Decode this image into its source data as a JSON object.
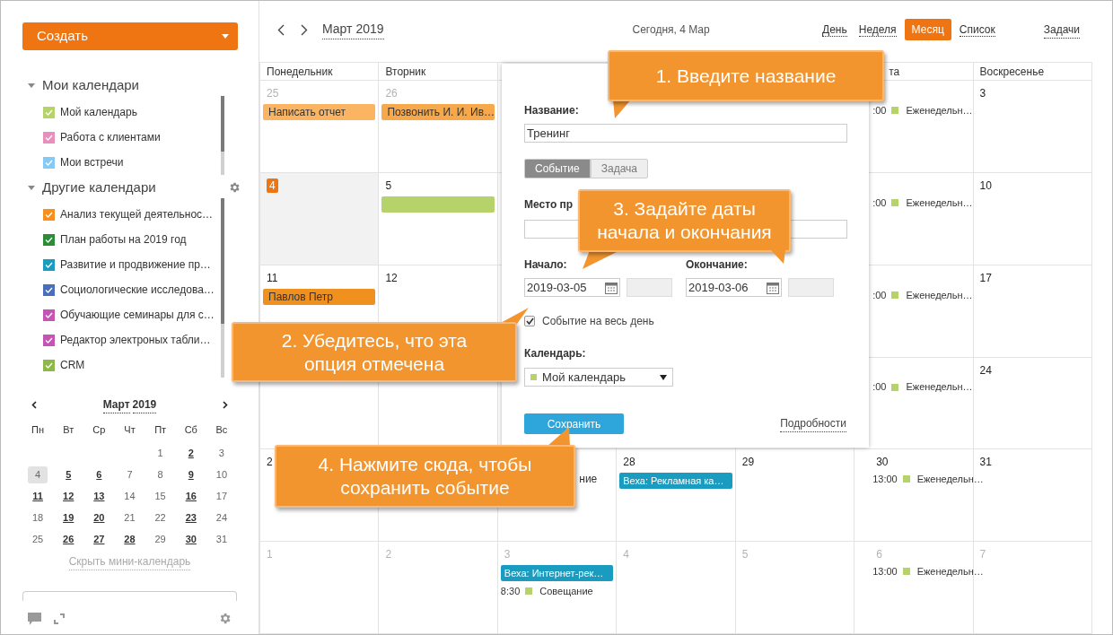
{
  "sidebar": {
    "create_button": "Создать",
    "my_calendars": {
      "title": "Мои календари",
      "expanded": true,
      "items": [
        {
          "label": "Мой календарь",
          "color": "#b5d36a",
          "checked": true
        },
        {
          "label": "Работа с клиентами",
          "color": "#e88fbc",
          "checked": true
        },
        {
          "label": "Мои встречи",
          "color": "#86c9f4",
          "checked": true
        }
      ]
    },
    "other_calendars": {
      "title": "Другие календари",
      "expanded": true,
      "items": [
        {
          "label": "Анализ текущей деятельнос…",
          "color": "#f7901e",
          "checked": true
        },
        {
          "label": "План работы на 2019 год",
          "color": "#2e8b3a",
          "checked": true
        },
        {
          "label": "Развитие и продвижение пр…",
          "color": "#1a9cc0",
          "checked": true
        },
        {
          "label": "Социологические исследова…",
          "color": "#4a6fb8",
          "checked": true
        },
        {
          "label": "Обучающие семинары для с…",
          "color": "#c455b5",
          "checked": true
        },
        {
          "label": "Редактор электроных табли…",
          "color": "#c455b5",
          "checked": true
        },
        {
          "label": "CRM",
          "color": "#8db84a",
          "checked": true
        }
      ]
    },
    "mini_calendar": {
      "month": "Март",
      "year": "2019",
      "weekdays": [
        "Пн",
        "Вт",
        "Ср",
        "Чт",
        "Пт",
        "Сб",
        "Вс"
      ],
      "weeks": [
        [
          {
            "day": "1",
            "has_events": false,
            "today": false
          },
          {
            "day": "2",
            "has_events": true,
            "today": false
          },
          {
            "day": "3",
            "has_events": false,
            "today": false
          }
        ],
        [
          {
            "day": "4",
            "has_events": false,
            "today": true
          },
          {
            "day": "5",
            "has_events": true,
            "today": false
          },
          {
            "day": "6",
            "has_events": true,
            "today": false
          },
          {
            "day": "7",
            "has_events": false,
            "today": false
          },
          {
            "day": "8",
            "has_events": false,
            "today": false
          },
          {
            "day": "9",
            "has_events": true,
            "today": false
          },
          {
            "day": "10",
            "has_events": false,
            "today": false
          }
        ],
        [
          {
            "day": "11",
            "has_events": true,
            "today": false
          },
          {
            "day": "12",
            "has_events": true,
            "today": false
          },
          {
            "day": "13",
            "has_events": true,
            "today": false
          },
          {
            "day": "14",
            "has_events": false,
            "today": false
          },
          {
            "day": "15",
            "has_events": false,
            "today": false
          },
          {
            "day": "16",
            "has_events": true,
            "today": false
          },
          {
            "day": "17",
            "has_events": false,
            "today": false
          }
        ],
        [
          {
            "day": "18",
            "has_events": false,
            "today": false
          },
          {
            "day": "19",
            "has_events": true,
            "today": false
          },
          {
            "day": "20",
            "has_events": true,
            "today": false
          },
          {
            "day": "21",
            "has_events": false,
            "today": false
          },
          {
            "day": "22",
            "has_events": false,
            "today": false
          },
          {
            "day": "23",
            "has_events": true,
            "today": false
          },
          {
            "day": "24",
            "has_events": false,
            "today": false
          }
        ],
        [
          {
            "day": "25",
            "has_events": false,
            "today": false
          },
          {
            "day": "26",
            "has_events": true,
            "today": false
          },
          {
            "day": "27",
            "has_events": true,
            "today": false
          },
          {
            "day": "28",
            "has_events": true,
            "today": false
          },
          {
            "day": "29",
            "has_events": false,
            "today": false
          },
          {
            "day": "30",
            "has_events": true,
            "today": false
          },
          {
            "day": "31",
            "has_events": false,
            "today": false
          }
        ]
      ],
      "hide_link": "Скрыть мини-календарь"
    }
  },
  "toolbar": {
    "period": "Март 2019",
    "today": "Сегодня, 4 Мар",
    "views": [
      {
        "label": "День",
        "selected": false
      },
      {
        "label": "Неделя",
        "selected": false
      },
      {
        "label": "Месяц",
        "selected": true
      },
      {
        "label": "Список",
        "selected": false
      }
    ],
    "tasks": "Задачи"
  },
  "calendar": {
    "columns": {
      "mon": "Понедельник",
      "tue": "Вторник",
      "sat": "та",
      "sun": "Воскресенье"
    },
    "weeks": [
      {
        "mon": {
          "day": "25",
          "muted": true,
          "today": false,
          "events": [
            {
              "kind": "bar",
              "title": "Написать отчет",
              "color": "#fbb462"
            }
          ]
        },
        "tue": {
          "day": "26",
          "muted": true,
          "today": false,
          "events": [
            {
              "kind": "bar",
              "title": "Позвонить И. И. Ив…",
              "color": "#f7a84a"
            }
          ]
        },
        "sat": {
          "events": [
            {
              "kind": "timed",
              "time": ":00",
              "title": "Еженедельн…",
              "color": "#b5d36a"
            }
          ]
        },
        "sun": {
          "day": "3",
          "muted": false,
          "today": false
        }
      },
      {
        "mon": {
          "day": "4",
          "muted": false,
          "today": true
        },
        "tue": {
          "day": "5",
          "muted": false,
          "today": false,
          "events": [
            {
              "kind": "bar",
              "color": "#b5d36a"
            }
          ]
        },
        "sat": {
          "events": [
            {
              "kind": "timed",
              "time": ":00",
              "title": "Еженедельн…",
              "color": "#b5d36a"
            }
          ]
        },
        "sun": {
          "day": "10",
          "muted": false,
          "today": false
        }
      },
      {
        "mon": {
          "day": "11",
          "muted": false,
          "today": false,
          "events": [
            {
              "kind": "bar",
              "title": "Павлов Петр",
              "color": "#f0901e"
            }
          ]
        },
        "tue": {
          "day": "12",
          "muted": false,
          "today": false
        },
        "sat": {
          "events": [
            {
              "kind": "timed",
              "time": ":00",
              "title": "Еженедельн…",
              "color": "#b5d36a"
            }
          ]
        },
        "sun": {
          "day": "17",
          "muted": false,
          "today": false
        }
      },
      {
        "sat": {
          "events": [
            {
              "kind": "timed",
              "time": ":00",
              "title": "Еженедельн…",
              "color": "#b5d36a"
            }
          ]
        },
        "sun": {
          "day": "24",
          "muted": false,
          "today": false
        }
      },
      {
        "mon": {
          "day": "2",
          "muted": false,
          "today": false
        },
        "wed": {
          "events": [
            {
              "kind": "fragment",
              "title": "ние"
            }
          ]
        },
        "thu": {
          "day": "28",
          "muted": false,
          "today": false,
          "events": [
            {
              "kind": "milestone",
              "title": "Веха: Рекламная ка…",
              "color": "#1a9cc0"
            }
          ]
        },
        "fri": {
          "day": "29",
          "muted": false,
          "today": false
        },
        "sat": {
          "day": "30",
          "muted": false,
          "today": false,
          "events": [
            {
              "kind": "timed",
              "time": "13:00",
              "title": "Еженедельн…",
              "color": "#b5d36a"
            }
          ]
        },
        "sun": {
          "day": "31",
          "muted": false,
          "today": false
        }
      },
      {
        "mon": {
          "day": "1",
          "muted": true,
          "today": false
        },
        "tue": {
          "day": "2",
          "muted": true,
          "today": false
        },
        "wed": {
          "day": "3",
          "muted": true,
          "today": false,
          "events": [
            {
              "kind": "milestone",
              "title": "Веха: Интернет-рек…",
              "color": "#1a9cc0"
            },
            {
              "kind": "timed",
              "time": "8:30",
              "title": "Совещание",
              "color": "#b5d36a"
            }
          ]
        },
        "thu": {
          "day": "4",
          "muted": true,
          "today": false
        },
        "fri": {
          "day": "5",
          "muted": true,
          "today": false
        },
        "sat": {
          "day": "6",
          "muted": true,
          "today": false,
          "events": [
            {
              "kind": "timed",
              "time": "13:00",
              "title": "Еженедельн…",
              "color": "#b5d36a"
            }
          ]
        },
        "sun": {
          "day": "7",
          "muted": true,
          "today": false
        }
      }
    ]
  },
  "event_popup": {
    "title_label": "Название:",
    "title_value": "Тренинг",
    "types": [
      {
        "label": "Событие",
        "selected": true
      },
      {
        "label": "Задача",
        "selected": false
      }
    ],
    "place_label": "Место пр",
    "start_label": "Начало:",
    "start_date": "2019-03-05",
    "end_label": "Окончание:",
    "end_date": "2019-03-06",
    "all_day": {
      "label": "Событие на весь день",
      "checked": true
    },
    "calendar_label": "Календарь:",
    "calendar": {
      "label": "Мой календарь",
      "color": "#b5d36a"
    },
    "save_button": "Сохранить",
    "details_link": "Подробности"
  },
  "callouts": [
    {
      "text": "1. Введите название"
    },
    {
      "text": "2. Убедитесь, что эта опция отмечена"
    },
    {
      "text": "3. Задайте даты начала и окончания"
    },
    {
      "text": "4. Нажмите сюда, чтобы сохранить событие"
    }
  ]
}
